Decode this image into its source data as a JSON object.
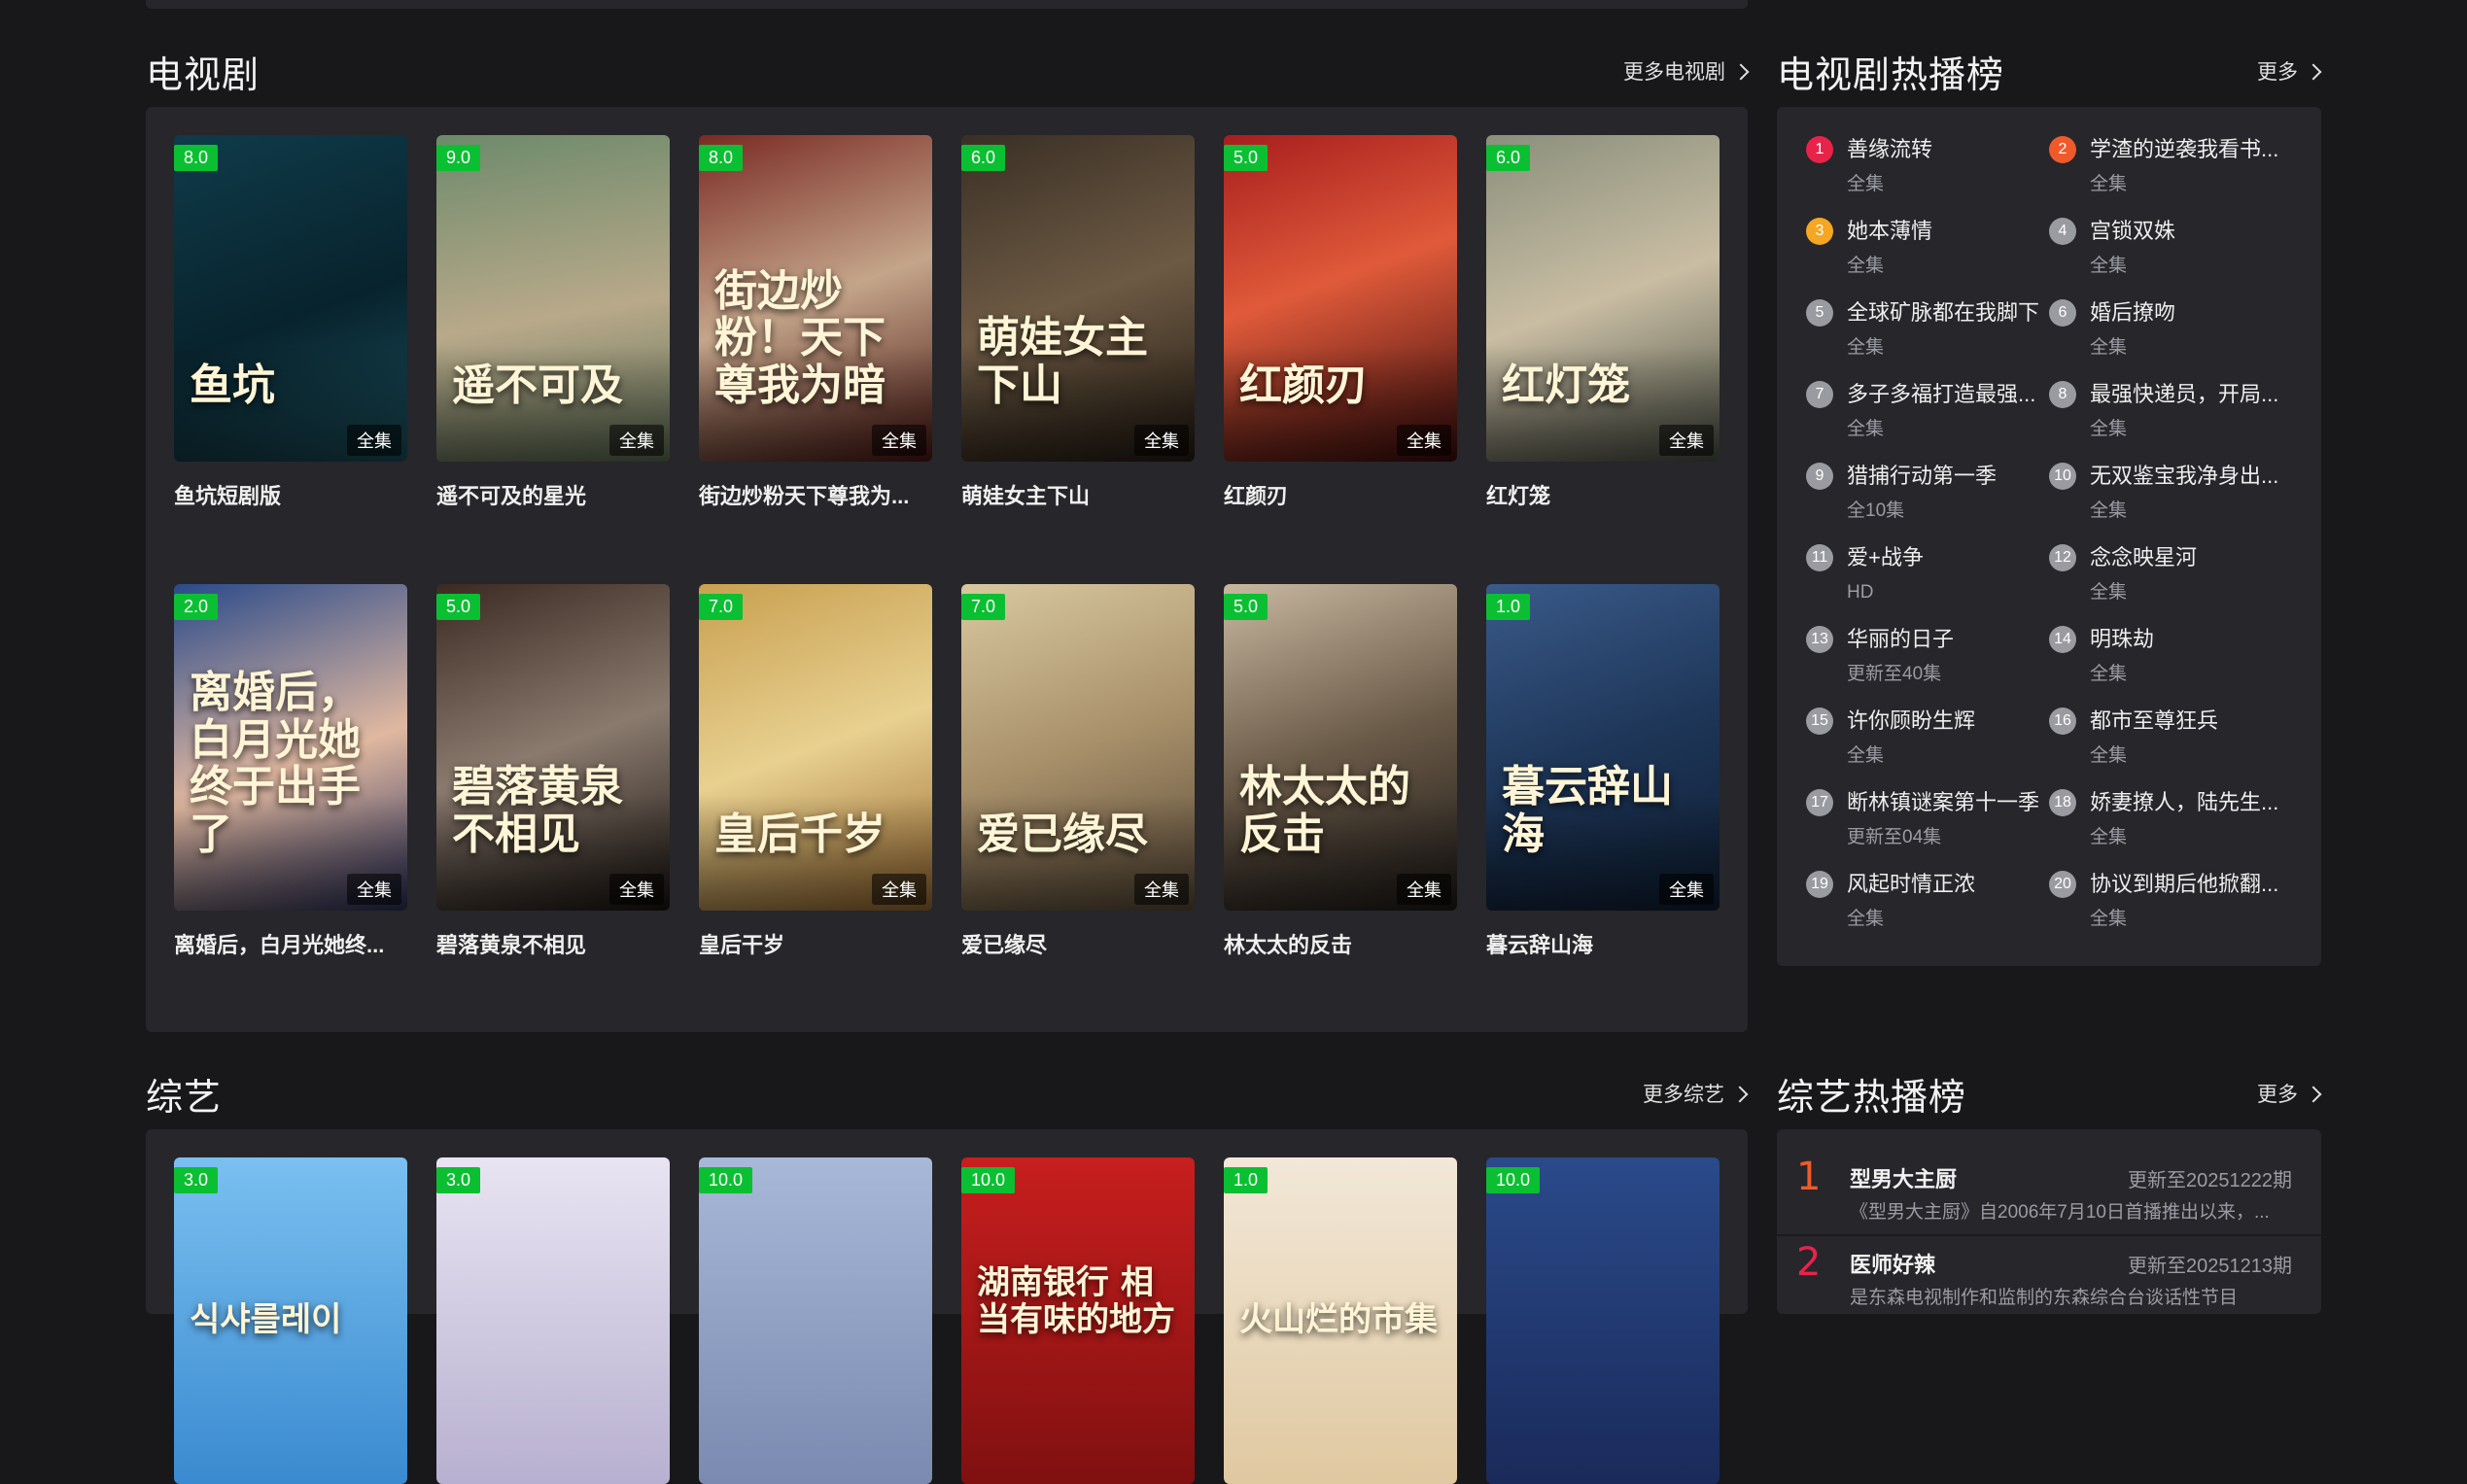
{
  "tv": {
    "title": "电视剧",
    "more": "更多电视剧",
    "items": [
      {
        "title": "鱼坑短剧版",
        "score": "8.0",
        "episode": "全集",
        "poster_text": "鱼坑"
      },
      {
        "title": "遥不可及的星光",
        "score": "9.0",
        "episode": "全集",
        "poster_text": "遥不可及"
      },
      {
        "title": "街边炒粉天下尊我为...",
        "score": "8.0",
        "episode": "全集",
        "poster_text": "街边炒粉！天下尊我为暗"
      },
      {
        "title": "萌娃女主下山",
        "score": "6.0",
        "episode": "全集",
        "poster_text": "萌娃女主下山"
      },
      {
        "title": "红颜刃",
        "score": "5.0",
        "episode": "全集",
        "poster_text": "红颜刃"
      },
      {
        "title": "红灯笼",
        "score": "6.0",
        "episode": "全集",
        "poster_text": "红灯笼"
      },
      {
        "title": "离婚后，白月光她终...",
        "score": "2.0",
        "episode": "全集",
        "poster_text": "离婚后，白月光她终于出手了"
      },
      {
        "title": "碧落黄泉不相见",
        "score": "5.0",
        "episode": "全集",
        "poster_text": "碧落黄泉不相见"
      },
      {
        "title": "皇后干岁",
        "score": "7.0",
        "episode": "全集",
        "poster_text": "皇后千岁"
      },
      {
        "title": "爱已缘尽",
        "score": "7.0",
        "episode": "全集",
        "poster_text": "爱已缘尽"
      },
      {
        "title": "林太太的反击",
        "score": "5.0",
        "episode": "全集",
        "poster_text": "林太太的反击"
      },
      {
        "title": "暮云辞山海",
        "score": "1.0",
        "episode": "全集",
        "poster_text": "暮云辞山海"
      }
    ]
  },
  "tv_rank": {
    "title": "电视剧热播榜",
    "more": "更多",
    "items": [
      {
        "rank": "1",
        "name": "善缘流转",
        "sub": "全集"
      },
      {
        "rank": "2",
        "name": "学渣的逆袭我看书...",
        "sub": "全集"
      },
      {
        "rank": "3",
        "name": "她本薄情",
        "sub": "全集"
      },
      {
        "rank": "4",
        "name": "宫锁双姝",
        "sub": "全集"
      },
      {
        "rank": "5",
        "name": "全球矿脉都在我脚下",
        "sub": "全集"
      },
      {
        "rank": "6",
        "name": "婚后撩吻",
        "sub": "全集"
      },
      {
        "rank": "7",
        "name": "多子多福打造最强...",
        "sub": "全集"
      },
      {
        "rank": "8",
        "name": "最强快递员，开局...",
        "sub": "全集"
      },
      {
        "rank": "9",
        "name": "猎捕行动第一季",
        "sub": "全10集"
      },
      {
        "rank": "10",
        "name": "无双鉴宝我净身出...",
        "sub": "全集"
      },
      {
        "rank": "11",
        "name": "爱+战争",
        "sub": "HD"
      },
      {
        "rank": "12",
        "name": "念念映星河",
        "sub": "全集"
      },
      {
        "rank": "13",
        "name": "华丽的日子",
        "sub": "更新至40集"
      },
      {
        "rank": "14",
        "name": "明珠劫",
        "sub": "全集"
      },
      {
        "rank": "15",
        "name": "许你顾盼生辉",
        "sub": "全集"
      },
      {
        "rank": "16",
        "name": "都市至尊狂兵",
        "sub": "全集"
      },
      {
        "rank": "17",
        "name": "断林镇谜案第十一季",
        "sub": "更新至04集"
      },
      {
        "rank": "18",
        "name": "娇妻撩人，陆先生...",
        "sub": "全集"
      },
      {
        "rank": "19",
        "name": "风起时情正浓",
        "sub": "全集"
      },
      {
        "rank": "20",
        "name": "协议到期后他掀翻...",
        "sub": "全集"
      }
    ]
  },
  "variety": {
    "title": "综艺",
    "more": "更多综艺",
    "items": [
      {
        "score": "3.0",
        "poster_text": "식샤를레이"
      },
      {
        "score": "3.0",
        "poster_text": ""
      },
      {
        "score": "10.0",
        "poster_text": ""
      },
      {
        "score": "10.0",
        "poster_text": "湖南银行 相当有味的地方"
      },
      {
        "score": "1.0",
        "poster_text": "火山烂的市集"
      },
      {
        "score": "10.0",
        "poster_text": ""
      }
    ]
  },
  "variety_rank": {
    "title": "综艺热播榜",
    "more": "更多",
    "items": [
      {
        "rank": "1",
        "name": "型男大主厨",
        "update": "更新至20251222期",
        "desc": "《型男大主厨》自2006年7月10日首播推出以来，..."
      },
      {
        "rank": "2",
        "name": "医师好辣",
        "update": "更新至20251213期",
        "desc": "是东森电视制作和监制的东森综合台谈话性节目"
      }
    ]
  },
  "colors": {
    "rank1": "#e8234a",
    "rank2": "#f05a2a",
    "rank3": "#f5a623",
    "rank_default": "#9a9aa1",
    "score_bg": "#0bbf32",
    "background": "#18181b",
    "panel": "#26262b"
  }
}
